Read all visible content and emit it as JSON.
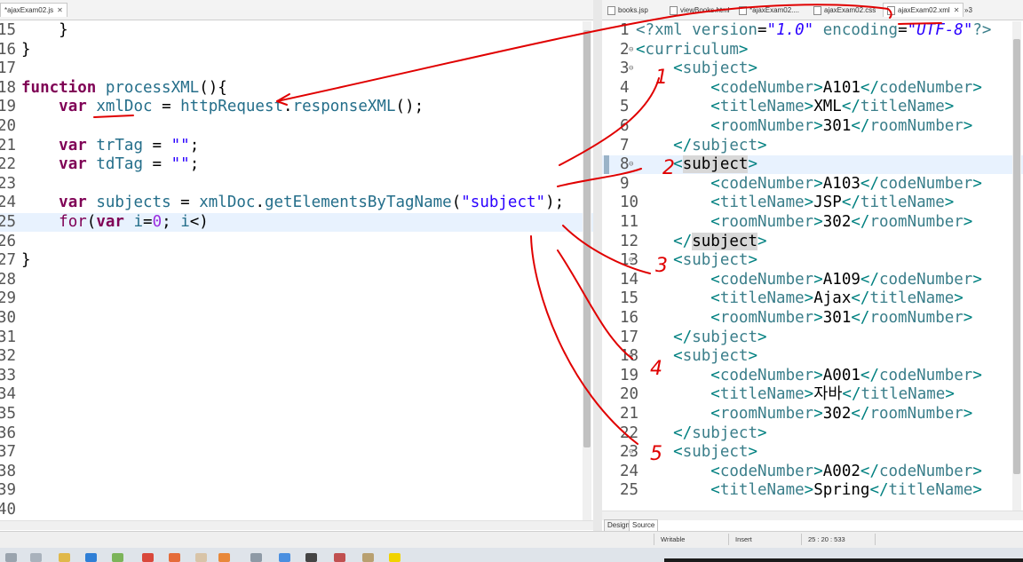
{
  "left_editor": {
    "tab_label": "*ajaxExam02.js",
    "close_glyph": "✕",
    "lines": [
      {
        "n": "15",
        "hl": false,
        "parts": [
          [
            "",
            "    }"
          ]
        ]
      },
      {
        "n": "16",
        "hl": false,
        "parts": [
          [
            "",
            "}"
          ]
        ]
      },
      {
        "n": "17",
        "hl": false,
        "parts": []
      },
      {
        "n": "18",
        "hl": false,
        "parts": [
          [
            "kw",
            "function"
          ],
          [
            "",
            " "
          ],
          [
            "idn",
            "processXML"
          ],
          [
            "",
            "(){"
          ]
        ]
      },
      {
        "n": "19",
        "hl": false,
        "parts": [
          [
            "",
            "    "
          ],
          [
            "kw",
            "var"
          ],
          [
            "",
            " "
          ],
          [
            "idn",
            "xmlDoc"
          ],
          [
            "",
            " = "
          ],
          [
            "idn",
            "httpRequest"
          ],
          [
            "",
            "."
          ],
          [
            "idn",
            "responseXML"
          ],
          [
            "",
            "();"
          ]
        ]
      },
      {
        "n": "20",
        "hl": false,
        "parts": []
      },
      {
        "n": "21",
        "hl": false,
        "parts": [
          [
            "",
            "    "
          ],
          [
            "kw",
            "var"
          ],
          [
            "",
            " "
          ],
          [
            "idn",
            "trTag"
          ],
          [
            "",
            " = "
          ],
          [
            "str",
            "\"\""
          ],
          [
            "",
            ";"
          ]
        ]
      },
      {
        "n": "22",
        "hl": false,
        "parts": [
          [
            "",
            "    "
          ],
          [
            "kw",
            "var"
          ],
          [
            "",
            " "
          ],
          [
            "idn",
            "tdTag"
          ],
          [
            "",
            " = "
          ],
          [
            "str",
            "\"\""
          ],
          [
            "",
            ";"
          ]
        ]
      },
      {
        "n": "23",
        "hl": false,
        "parts": []
      },
      {
        "n": "24",
        "hl": false,
        "parts": [
          [
            "",
            "    "
          ],
          [
            "kw",
            "var"
          ],
          [
            "",
            " "
          ],
          [
            "idn",
            "subjects"
          ],
          [
            "",
            " = "
          ],
          [
            "idn",
            "xmlDoc"
          ],
          [
            "",
            "."
          ],
          [
            "idn",
            "getElementsByTagName"
          ],
          [
            "",
            "("
          ],
          [
            "str",
            "\"subject\""
          ],
          [
            "",
            ");"
          ]
        ]
      },
      {
        "n": "25",
        "hl": true,
        "parts": [
          [
            "",
            "    "
          ],
          [
            "kf",
            "for"
          ],
          [
            "",
            "("
          ],
          [
            "kw",
            "var"
          ],
          [
            "",
            " "
          ],
          [
            "idn",
            "i"
          ],
          [
            "",
            "="
          ],
          [
            "num",
            "0"
          ],
          [
            "",
            "; "
          ],
          [
            "idn",
            "i"
          ],
          [
            "",
            "<)"
          ]
        ]
      },
      {
        "n": "26",
        "hl": false,
        "parts": []
      },
      {
        "n": "27",
        "hl": false,
        "parts": [
          [
            "",
            "}"
          ]
        ]
      },
      {
        "n": "28",
        "hl": false,
        "parts": []
      },
      {
        "n": "29",
        "hl": false,
        "parts": []
      },
      {
        "n": "30",
        "hl": false,
        "parts": []
      },
      {
        "n": "31",
        "hl": false,
        "parts": []
      },
      {
        "n": "32",
        "hl": false,
        "parts": []
      },
      {
        "n": "33",
        "hl": false,
        "parts": []
      },
      {
        "n": "34",
        "hl": false,
        "parts": []
      },
      {
        "n": "35",
        "hl": false,
        "parts": []
      },
      {
        "n": "36",
        "hl": false,
        "parts": []
      },
      {
        "n": "37",
        "hl": false,
        "parts": []
      },
      {
        "n": "38",
        "hl": false,
        "parts": []
      },
      {
        "n": "39",
        "hl": false,
        "parts": []
      },
      {
        "n": "40",
        "hl": false,
        "parts": []
      }
    ]
  },
  "right_editor": {
    "tabs": [
      {
        "label": "books.jsp",
        "active": false
      },
      {
        "label": "viewBooks.html",
        "active": false
      },
      {
        "label": "*ajaxExam02....",
        "active": false
      },
      {
        "label": "ajaxExam02.css",
        "active": false
      },
      {
        "label": "ajaxExam02.xml",
        "active": true
      }
    ],
    "overflow_label": "»3",
    "close_glyph": "✕",
    "lines": [
      {
        "n": "1",
        "hl": false,
        "fold": "",
        "parts": [
          [
            "pi",
            "<?xml "
          ],
          [
            "pi",
            "version"
          ],
          [
            "",
            "="
          ],
          [
            "av",
            "\"1.0\""
          ],
          [
            "",
            " "
          ],
          [
            "pi",
            "encoding"
          ],
          [
            "",
            "="
          ],
          [
            "av",
            "\"UTF-8\""
          ],
          [
            "pi",
            "?>"
          ]
        ]
      },
      {
        "n": "2",
        "hl": false,
        "fold": "⊖",
        "parts": [
          [
            "br",
            "<"
          ],
          [
            "tag",
            "curriculum"
          ],
          [
            "br",
            ">"
          ]
        ]
      },
      {
        "n": "3",
        "hl": false,
        "fold": "⊖",
        "parts": [
          [
            "",
            "    "
          ],
          [
            "br",
            "<"
          ],
          [
            "tag",
            "subject"
          ],
          [
            "br",
            ">"
          ]
        ]
      },
      {
        "n": "4",
        "hl": false,
        "fold": "",
        "parts": [
          [
            "",
            "        "
          ],
          [
            "br",
            "<"
          ],
          [
            "tag",
            "codeNumber"
          ],
          [
            "br",
            ">"
          ],
          [
            "",
            "A101"
          ],
          [
            "br",
            "</"
          ],
          [
            "tag",
            "codeNumber"
          ],
          [
            "br",
            ">"
          ]
        ]
      },
      {
        "n": "5",
        "hl": false,
        "fold": "",
        "parts": [
          [
            "",
            "        "
          ],
          [
            "br",
            "<"
          ],
          [
            "tag",
            "titleName"
          ],
          [
            "br",
            ">"
          ],
          [
            "",
            "XML"
          ],
          [
            "br",
            "</"
          ],
          [
            "tag",
            "titleName"
          ],
          [
            "br",
            ">"
          ]
        ]
      },
      {
        "n": "6",
        "hl": false,
        "fold": "",
        "parts": [
          [
            "",
            "        "
          ],
          [
            "br",
            "<"
          ],
          [
            "tag",
            "roomNumber"
          ],
          [
            "br",
            ">"
          ],
          [
            "",
            "301"
          ],
          [
            "br",
            "</"
          ],
          [
            "tag",
            "roomNumber"
          ],
          [
            "br",
            ">"
          ]
        ]
      },
      {
        "n": "7",
        "hl": false,
        "fold": "",
        "parts": [
          [
            "",
            "    "
          ],
          [
            "br",
            "</"
          ],
          [
            "tag",
            "subject"
          ],
          [
            "br",
            ">"
          ]
        ]
      },
      {
        "n": "8",
        "hl": true,
        "fold": "⊖",
        "parts": [
          [
            "",
            "    "
          ],
          [
            "br",
            "<"
          ],
          [
            "match",
            "subject"
          ],
          [
            "br",
            ">"
          ]
        ]
      },
      {
        "n": "9",
        "hl": false,
        "fold": "",
        "parts": [
          [
            "",
            "        "
          ],
          [
            "br",
            "<"
          ],
          [
            "tag",
            "codeNumber"
          ],
          [
            "br",
            ">"
          ],
          [
            "",
            "A103"
          ],
          [
            "br",
            "</"
          ],
          [
            "tag",
            "codeNumber"
          ],
          [
            "br",
            ">"
          ]
        ]
      },
      {
        "n": "10",
        "hl": false,
        "fold": "",
        "parts": [
          [
            "",
            "        "
          ],
          [
            "br",
            "<"
          ],
          [
            "tag",
            "titleName"
          ],
          [
            "br",
            ">"
          ],
          [
            "",
            "JSP"
          ],
          [
            "br",
            "</"
          ],
          [
            "tag",
            "titleName"
          ],
          [
            "br",
            ">"
          ]
        ]
      },
      {
        "n": "11",
        "hl": false,
        "fold": "",
        "parts": [
          [
            "",
            "        "
          ],
          [
            "br",
            "<"
          ],
          [
            "tag",
            "roomNumber"
          ],
          [
            "br",
            ">"
          ],
          [
            "",
            "302"
          ],
          [
            "br",
            "</"
          ],
          [
            "tag",
            "roomNumber"
          ],
          [
            "br",
            ">"
          ]
        ]
      },
      {
        "n": "12",
        "hl": false,
        "fold": "",
        "parts": [
          [
            "",
            "    "
          ],
          [
            "br",
            "</"
          ],
          [
            "match",
            "subject"
          ],
          [
            "br",
            ">"
          ]
        ]
      },
      {
        "n": "13",
        "hl": false,
        "fold": "⊖",
        "parts": [
          [
            "",
            "    "
          ],
          [
            "br",
            "<"
          ],
          [
            "tag",
            "subject"
          ],
          [
            "br",
            ">"
          ]
        ]
      },
      {
        "n": "14",
        "hl": false,
        "fold": "",
        "parts": [
          [
            "",
            "        "
          ],
          [
            "br",
            "<"
          ],
          [
            "tag",
            "codeNumber"
          ],
          [
            "br",
            ">"
          ],
          [
            "",
            "A109"
          ],
          [
            "br",
            "</"
          ],
          [
            "tag",
            "codeNumber"
          ],
          [
            "br",
            ">"
          ]
        ]
      },
      {
        "n": "15",
        "hl": false,
        "fold": "",
        "parts": [
          [
            "",
            "        "
          ],
          [
            "br",
            "<"
          ],
          [
            "tag",
            "titleName"
          ],
          [
            "br",
            ">"
          ],
          [
            "",
            "Ajax"
          ],
          [
            "br",
            "</"
          ],
          [
            "tag",
            "titleName"
          ],
          [
            "br",
            ">"
          ]
        ]
      },
      {
        "n": "16",
        "hl": false,
        "fold": "",
        "parts": [
          [
            "",
            "        "
          ],
          [
            "br",
            "<"
          ],
          [
            "tag",
            "roomNumber"
          ],
          [
            "br",
            ">"
          ],
          [
            "",
            "301"
          ],
          [
            "br",
            "</"
          ],
          [
            "tag",
            "roomNumber"
          ],
          [
            "br",
            ">"
          ]
        ]
      },
      {
        "n": "17",
        "hl": false,
        "fold": "",
        "parts": [
          [
            "",
            "    "
          ],
          [
            "br",
            "</"
          ],
          [
            "tag",
            "subject"
          ],
          [
            "br",
            ">"
          ]
        ]
      },
      {
        "n": "18",
        "hl": false,
        "fold": "⊖",
        "parts": [
          [
            "",
            "    "
          ],
          [
            "br",
            "<"
          ],
          [
            "tag",
            "subject"
          ],
          [
            "br",
            ">"
          ]
        ]
      },
      {
        "n": "19",
        "hl": false,
        "fold": "",
        "parts": [
          [
            "",
            "        "
          ],
          [
            "br",
            "<"
          ],
          [
            "tag",
            "codeNumber"
          ],
          [
            "br",
            ">"
          ],
          [
            "",
            "A001"
          ],
          [
            "br",
            "</"
          ],
          [
            "tag",
            "codeNumber"
          ],
          [
            "br",
            ">"
          ]
        ]
      },
      {
        "n": "20",
        "hl": false,
        "fold": "",
        "parts": [
          [
            "",
            "        "
          ],
          [
            "br",
            "<"
          ],
          [
            "tag",
            "titleName"
          ],
          [
            "br",
            ">"
          ],
          [
            "",
            "자바"
          ],
          [
            "br",
            "</"
          ],
          [
            "tag",
            "titleName"
          ],
          [
            "br",
            ">"
          ]
        ]
      },
      {
        "n": "21",
        "hl": false,
        "fold": "",
        "parts": [
          [
            "",
            "        "
          ],
          [
            "br",
            "<"
          ],
          [
            "tag",
            "roomNumber"
          ],
          [
            "br",
            ">"
          ],
          [
            "",
            "302"
          ],
          [
            "br",
            "</"
          ],
          [
            "tag",
            "roomNumber"
          ],
          [
            "br",
            ">"
          ]
        ]
      },
      {
        "n": "22",
        "hl": false,
        "fold": "",
        "parts": [
          [
            "",
            "    "
          ],
          [
            "br",
            "</"
          ],
          [
            "tag",
            "subject"
          ],
          [
            "br",
            ">"
          ]
        ]
      },
      {
        "n": "23",
        "hl": false,
        "fold": "⊖",
        "parts": [
          [
            "",
            "    "
          ],
          [
            "br",
            "<"
          ],
          [
            "tag",
            "subject"
          ],
          [
            "br",
            ">"
          ]
        ]
      },
      {
        "n": "24",
        "hl": false,
        "fold": "",
        "parts": [
          [
            "",
            "        "
          ],
          [
            "br",
            "<"
          ],
          [
            "tag",
            "codeNumber"
          ],
          [
            "br",
            ">"
          ],
          [
            "",
            "A002"
          ],
          [
            "br",
            "</"
          ],
          [
            "tag",
            "codeNumber"
          ],
          [
            "br",
            ">"
          ]
        ]
      },
      {
        "n": "25",
        "hl": false,
        "fold": "",
        "parts": [
          [
            "",
            "        "
          ],
          [
            "br",
            "<"
          ],
          [
            "tag",
            "titleName"
          ],
          [
            "br",
            ">"
          ],
          [
            "",
            "Spring"
          ],
          [
            "br",
            "</"
          ],
          [
            "tag",
            "titleName"
          ],
          [
            "br",
            ">"
          ]
        ]
      }
    ],
    "bottom_tabs": [
      {
        "label": "Design",
        "active": false
      },
      {
        "label": "Source",
        "active": true
      }
    ]
  },
  "status_bar": {
    "mode": "Writable",
    "insert": "Insert",
    "position": "25 : 20 : 533"
  },
  "annotation_numbers": [
    "1",
    "2",
    "3",
    "4",
    "5"
  ],
  "colors": {
    "annotation": "#e00000",
    "keyword": "#7f0055",
    "string": "#2a00ff",
    "current_line": "#e8f2fe"
  }
}
